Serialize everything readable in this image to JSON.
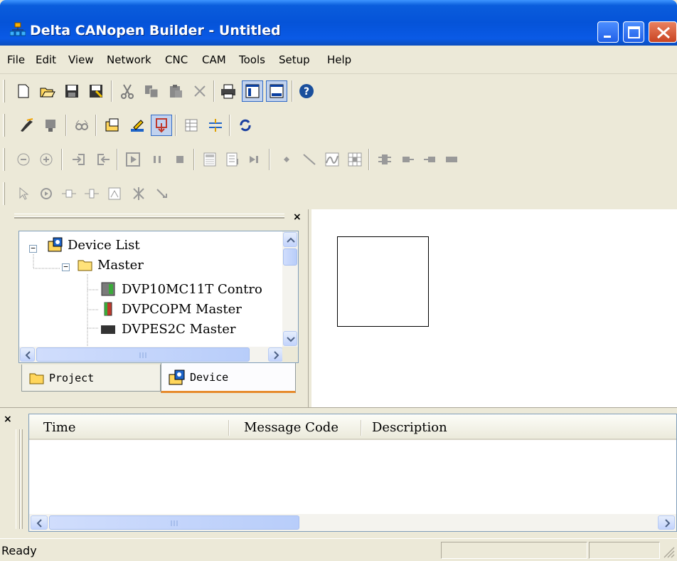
{
  "window": {
    "title": "Delta CANopen Builder - Untitled",
    "controls": [
      "minimize-button",
      "maximize-button",
      "close-button"
    ]
  },
  "menu": [
    "File",
    "Edit",
    "View",
    "Network",
    "CNC",
    "CAM",
    "Tools",
    "Setup",
    "Help"
  ],
  "toolbars": {
    "standard": [
      "new-icon",
      "open-icon",
      "save-icon",
      "save-as-icon",
      "cut-icon",
      "copy-icon",
      "paste-icon",
      "delete-icon",
      "print-icon",
      "view-tree-icon",
      "view-list-icon",
      "help-icon"
    ],
    "network": [
      "connect-icon",
      "device-icon",
      "monitor-icon",
      "folder-icon",
      "edit-icon",
      "download-icon",
      "table-icon",
      "sync-icon",
      "refresh-icon"
    ],
    "motion": [
      "zoom-out-icon",
      "zoom-in-icon",
      "input-icon",
      "output-icon",
      "run-icon",
      "pause-icon",
      "stop-icon",
      "calc-icon",
      "list-icon",
      "step-icon",
      "point-icon",
      "line-icon",
      "curve-icon",
      "grid-icon",
      "block-a-icon",
      "block-b-icon",
      "block-c-icon",
      "block-d-icon"
    ],
    "draw": [
      "pointer-icon",
      "circle-node-icon",
      "node-in-icon",
      "node-out-icon",
      "frame-icon",
      "cross-icon",
      "link-icon"
    ]
  },
  "tree": {
    "root": "Device List",
    "master_folder": "Master",
    "devices": [
      "DVP10MC11T Contro",
      "DVPCOPM Master",
      "DVPES2C Master"
    ]
  },
  "tabs": {
    "project": "Project",
    "device": "Device"
  },
  "messages": {
    "columns": [
      "Time",
      "Message Code",
      "Description"
    ]
  },
  "status": {
    "text": "Ready"
  }
}
